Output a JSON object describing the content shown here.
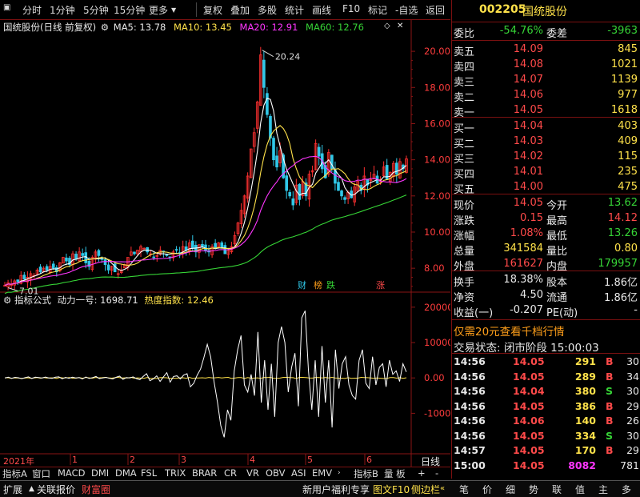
{
  "toolbar": {
    "items": [
      "分时",
      "1分钟",
      "5分钟",
      "15分钟",
      "更多",
      "复权",
      "叠加",
      "多股",
      "统计",
      "画线",
      "F10",
      "标记",
      "-自选",
      "返回"
    ]
  },
  "stock": {
    "code": "002205",
    "name": "国统股份"
  },
  "main_title": {
    "label": "国统股份(日线 前复权)",
    "ma5": "MA5: 13.78",
    "ma10": "MA10: 13.45",
    "ma20": "MA20: 12.91",
    "ma60": "MA60: 12.76"
  },
  "indicator_title": {
    "label": "指标公式",
    "value1": "动力一号: 1698.71",
    "value2": "热度指数: 12.46"
  },
  "markers": {
    "cai": "财",
    "bang": "榜",
    "die": "跌",
    "zhang": "涨"
  },
  "x_axis": {
    "start": "2021年",
    "months": [
      "1",
      "2",
      "3",
      "4",
      "5",
      "6"
    ],
    "mode": "日线"
  },
  "chart_data": {
    "type": "candlestick",
    "price_axis": {
      "ticks": [
        20.0,
        18.0,
        16.0,
        14.0,
        12.0,
        10.0,
        8.0
      ],
      "labels": [
        "20.00",
        "18.00",
        "16.00",
        "14.00",
        "12.00",
        "10.00",
        "8.00"
      ],
      "range": [
        6.9,
        21.2
      ]
    },
    "annotations": {
      "high": "20.24",
      "low": "7.01"
    },
    "indicator_axis": {
      "ticks": [
        20000,
        10000,
        0,
        -10000
      ],
      "labels": [
        "20000",
        "10000",
        "0.00",
        "-10000"
      ],
      "range": [
        -21000,
        22000
      ]
    },
    "series_names": [
      "MA5",
      "MA10",
      "MA20",
      "MA60"
    ],
    "colors": {
      "up": "#ff3030",
      "down": "#30c8e8",
      "ma5": "#ffffff",
      "ma10": "#ffe24a",
      "ma20": "#ff36ff",
      "ma60": "#36d436"
    },
    "closes": [
      7.05,
      7.2,
      7.1,
      7.3,
      7.25,
      7.6,
      7.4,
      7.5,
      7.7,
      7.6,
      7.9,
      7.8,
      8.0,
      7.9,
      8.1,
      8.0,
      7.8,
      8.3,
      8.6,
      8.4,
      8.2,
      8.8,
      8.5,
      8.9,
      8.7,
      8.3,
      8.1,
      8.6,
      8.9,
      8.7,
      8.5,
      8.2,
      7.9,
      8.1,
      7.8,
      7.7,
      7.9,
      8.2,
      8.6,
      8.9,
      8.8,
      9.0,
      9.2,
      9.1,
      8.9,
      8.8,
      8.6,
      8.7,
      9.0,
      8.9,
      8.7,
      8.6,
      8.9,
      9.0,
      8.8,
      9.2,
      9.0,
      9.4,
      9.1,
      8.9,
      9.3,
      9.2,
      9.0,
      8.9,
      9.2,
      9.1,
      9.4,
      9.1,
      8.8,
      9.0,
      9.2,
      9.8,
      10.5,
      11.2,
      12.0,
      13.1,
      14.6,
      15.5,
      17.2,
      19.8,
      18.0,
      16.5,
      15.2,
      14.0,
      13.6,
      14.5,
      13.0,
      12.3,
      12.0,
      11.5,
      12.6,
      11.8,
      12.8,
      12.0,
      13.2,
      13.4,
      14.9,
      14.2,
      13.5,
      13.0,
      14.4,
      13.5,
      12.7,
      12.3,
      12.0,
      11.8,
      12.2,
      11.9,
      12.5,
      12.8,
      12.3,
      13.1,
      12.6,
      12.9,
      13.2,
      12.7,
      12.9,
      13.6,
      12.9,
      13.3,
      13.8,
      13.2,
      13.9,
      13.5,
      14.05
    ],
    "indicator": [
      0,
      200,
      -100,
      150,
      50,
      -200,
      100,
      300,
      -150,
      200,
      100,
      -50,
      250,
      0,
      -100,
      200,
      300,
      -250,
      150,
      -100,
      200,
      0,
      100,
      -300,
      250,
      -150,
      100,
      400,
      -200,
      0,
      150,
      -100,
      -300,
      200,
      500,
      -400,
      100,
      0,
      300,
      -200,
      -500,
      400,
      1200,
      -800,
      -300,
      600,
      -1000,
      300,
      1500,
      -1200,
      400,
      600,
      -300,
      800,
      1200,
      -2500,
      -1500,
      800,
      2500,
      5800,
      9500,
      6000,
      -1000,
      -6800,
      -13500,
      -16800,
      -9000,
      -12000,
      2000,
      8000,
      12000,
      -2000,
      -4000,
      1000,
      -5000,
      13000,
      -7000,
      5000,
      -9000,
      4000,
      -11000,
      10000,
      14500,
      10000,
      -4000,
      3000,
      7000,
      -8000,
      17000,
      19000,
      2000,
      -9000,
      5000,
      -11000,
      9000,
      -7000,
      5000,
      -14000,
      8000,
      -3000,
      4000,
      6000,
      -2000,
      -5000,
      -6000,
      5000,
      8000,
      -1500,
      -3000,
      6000,
      -2000,
      3000,
      4000,
      -2500,
      5000,
      1000,
      2000,
      -1000,
      4000,
      1698.71
    ]
  },
  "quote": {
    "weibi_label": "委比",
    "weibi_value": "-54.76%",
    "weicha_label": "委差",
    "weicha_value": "-3963",
    "asks": [
      {
        "label": "卖五",
        "price": "14.09",
        "vol": "845"
      },
      {
        "label": "卖四",
        "price": "14.08",
        "vol": "1021"
      },
      {
        "label": "卖三",
        "price": "14.07",
        "vol": "1139"
      },
      {
        "label": "卖二",
        "price": "14.06",
        "vol": "977"
      },
      {
        "label": "卖一",
        "price": "14.05",
        "vol": "1618"
      }
    ],
    "bids": [
      {
        "label": "买一",
        "price": "14.04",
        "vol": "403"
      },
      {
        "label": "买二",
        "price": "14.03",
        "vol": "409"
      },
      {
        "label": "买三",
        "price": "14.02",
        "vol": "115"
      },
      {
        "label": "买四",
        "price": "14.01",
        "vol": "235"
      },
      {
        "label": "买五",
        "price": "14.00",
        "vol": "475"
      }
    ],
    "stats": [
      {
        "l1": "现价",
        "v1": "14.05",
        "c1": "red",
        "l2": "今开",
        "v2": "13.62",
        "c2": "green"
      },
      {
        "l1": "涨跌",
        "v1": "0.15",
        "c1": "red",
        "l2": "最高",
        "v2": "14.12",
        "c2": "red"
      },
      {
        "l1": "涨幅",
        "v1": "1.08%",
        "c1": "red",
        "l2": "最低",
        "v2": "13.26",
        "c2": "green"
      },
      {
        "l1": "总量",
        "v1": "341584",
        "c1": "yellow",
        "l2": "量比",
        "v2": "0.80",
        "c2": "yellow"
      },
      {
        "l1": "外盘",
        "v1": "161627",
        "c1": "red",
        "l2": "内盘",
        "v2": "179957",
        "c2": "green"
      }
    ],
    "extra": [
      {
        "l1": "换手",
        "v1": "18.38%",
        "l2": "股本",
        "v2": "1.86亿"
      },
      {
        "l1": "净资",
        "v1": "4.50",
        "l2": "流通",
        "v2": "1.86亿"
      },
      {
        "l1": "收益(一)",
        "v1": "-0.207",
        "l2": "PE(动)",
        "v2": "-"
      }
    ],
    "promo": "仅需20元查看千档行情",
    "trade_status": "交易状态: 闭市阶段 15:00:03"
  },
  "ticks": [
    {
      "t": "14:56",
      "p": "14.05",
      "v": "291",
      "bs": "B",
      "n": "30",
      "vc": "yellow",
      "bc": "red"
    },
    {
      "t": "14:56",
      "p": "14.05",
      "v": "289",
      "bs": "B",
      "n": "34",
      "vc": "yellow",
      "bc": "red"
    },
    {
      "t": "14:56",
      "p": "14.04",
      "v": "380",
      "bs": "S",
      "n": "30",
      "vc": "yellow",
      "bc": "green"
    },
    {
      "t": "14:56",
      "p": "14.05",
      "v": "386",
      "bs": "B",
      "n": "29",
      "vc": "yellow",
      "bc": "red"
    },
    {
      "t": "14:56",
      "p": "14.06",
      "v": "140",
      "bs": "B",
      "n": "26",
      "vc": "yellow",
      "bc": "red"
    },
    {
      "t": "14:56",
      "p": "14.05",
      "v": "334",
      "bs": "S",
      "n": "30",
      "vc": "yellow",
      "bc": "green"
    },
    {
      "t": "14:57",
      "p": "14.05",
      "v": "170",
      "bs": "B",
      "n": "29",
      "vc": "yellow",
      "bc": "red"
    },
    {
      "t": "15:00",
      "p": "14.05",
      "v": "8082",
      "bs": "",
      "n": "781",
      "vc": "magenta",
      "bc": "red"
    }
  ],
  "indicator_tabs": [
    "指标A",
    "窗口",
    "MACD",
    "DMI",
    "DMA",
    "FSL",
    "TRIX",
    "BRAR",
    "CR",
    "VR",
    "OBV",
    "ASI",
    "EMV",
    "指标B",
    "量 板",
    "+",
    "-"
  ],
  "statusbar": {
    "left": [
      "扩展",
      "关联报价",
      "财富圈"
    ],
    "mid1": "新用户福利专享",
    "mid2": "图文F10",
    "mid3": "侧边栏",
    "nav": [
      "笔",
      "价",
      "细",
      "势",
      "联",
      "值",
      "主",
      "多"
    ]
  }
}
